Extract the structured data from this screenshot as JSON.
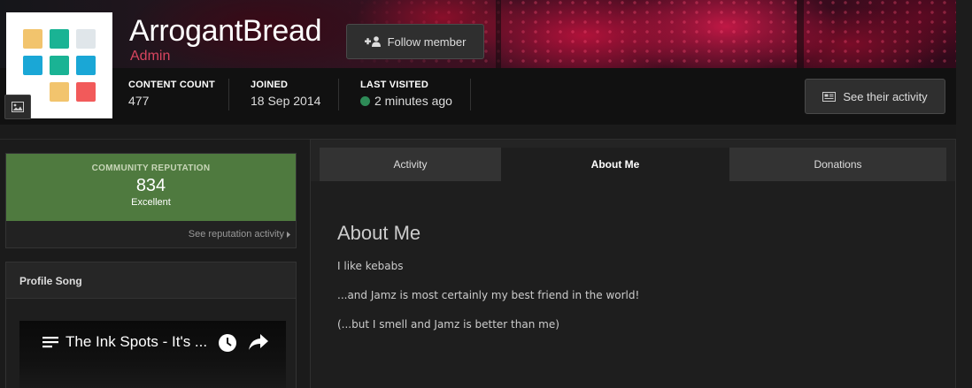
{
  "profile": {
    "username": "ArrogantBread",
    "group": "Admin",
    "group_color": "#d9455f",
    "follow_label": "Follow member",
    "activity_label": "See their activity"
  },
  "stats": {
    "content_count_label": "CONTENT COUNT",
    "content_count_value": "477",
    "joined_label": "JOINED",
    "joined_value": "18 Sep 2014",
    "last_visited_label": "LAST VISITED",
    "last_visited_value": "2 minutes ago"
  },
  "reputation": {
    "title": "COMMUNITY REPUTATION",
    "value": "834",
    "description": "Excellent",
    "link": "See reputation activity",
    "color": "#4f7a3f"
  },
  "profile_song": {
    "heading": "Profile Song",
    "video_title": "The Ink Spots - It's ..."
  },
  "tabs": [
    {
      "label": "Activity",
      "active": false
    },
    {
      "label": "About Me",
      "active": true
    },
    {
      "label": "Donations",
      "active": false
    }
  ],
  "about": {
    "title": "About Me",
    "lines": [
      "I like kebabs",
      "...and Jamz is most certainly my best friend in the world!",
      "(...but I smell and Jamz is better than me)"
    ]
  },
  "icons": {
    "follow": "add-user-icon",
    "activity": "newspaper-icon",
    "cover_photo": "image-icon",
    "online": "online-status-icon",
    "caret": "caret-right-icon",
    "playlist": "playlist-icon",
    "watch_later": "clock-icon",
    "share": "share-icon"
  }
}
